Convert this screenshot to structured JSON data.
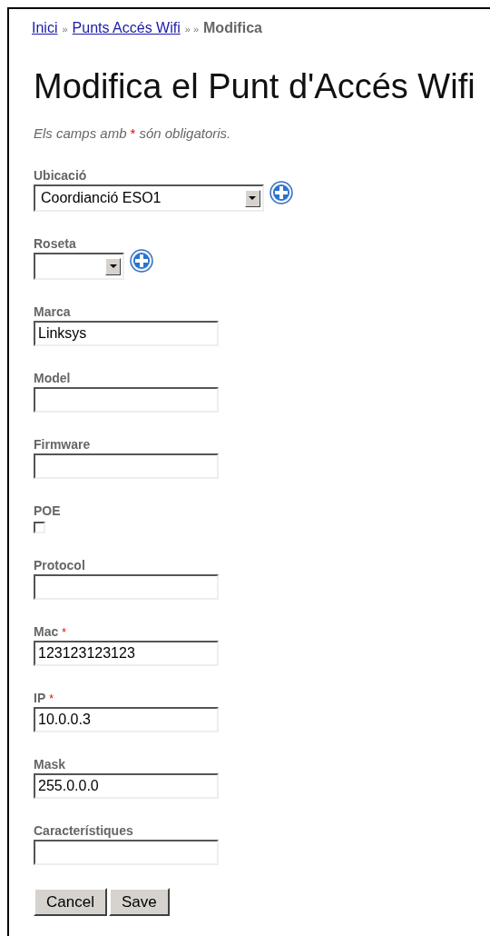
{
  "breadcrumb": [
    {
      "kind": "link",
      "text": "Inici"
    },
    {
      "kind": "separator",
      "text": "»"
    },
    {
      "kind": "link",
      "text": "Punts Accés Wifi"
    },
    {
      "kind": "separator",
      "text": "» »"
    },
    {
      "kind": "current",
      "text": "Modifica"
    }
  ],
  "title": "Modifica el Punt d'Accés Wifi",
  "note": {
    "before": "Els camps amb",
    "mark": "*",
    "after": "són obligatoris."
  },
  "fields": [
    {
      "kind": "select",
      "label": "Ubicació",
      "required": false,
      "value": "Coordianció ESO1",
      "add_button": true
    },
    {
      "kind": "select",
      "label": "Roseta",
      "required": false,
      "add_button": true
    },
    {
      "kind": "text",
      "label": "Marca",
      "required": false,
      "value": "Linksys"
    },
    {
      "kind": "text",
      "label": "Model",
      "required": false
    },
    {
      "kind": "text",
      "label": "Firmware",
      "required": false
    },
    {
      "kind": "checkbox",
      "label": "POE",
      "required": false,
      "checked": false
    },
    {
      "kind": "text",
      "label": "Protocol",
      "required": false
    },
    {
      "kind": "text",
      "label": "Mac",
      "required": true,
      "required_mark": "*",
      "value": "123123123123"
    },
    {
      "kind": "text",
      "label": "IP",
      "required": true,
      "required_mark": "*",
      "value": "10.0.0.3"
    },
    {
      "kind": "text",
      "label": "Mask",
      "required": false,
      "value": "255.0.0.0"
    },
    {
      "kind": "text",
      "label": "Característiques",
      "required": false
    }
  ],
  "buttons": [
    "Cancel",
    "Save"
  ]
}
